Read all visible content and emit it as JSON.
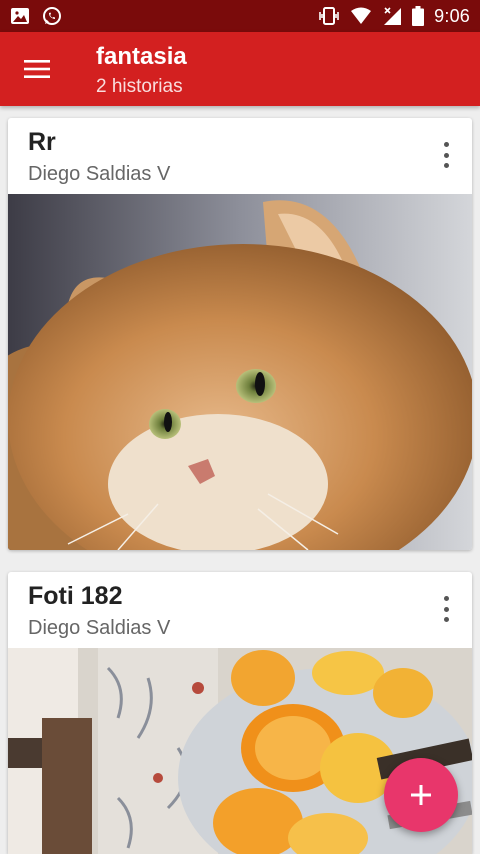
{
  "status_bar": {
    "time": "9:06",
    "icons": [
      "image-icon",
      "whatsapp-icon",
      "vibrate-icon",
      "wifi-icon",
      "signal-icon",
      "battery-icon"
    ]
  },
  "app_bar": {
    "title": "fantasia",
    "subtitle": "2 historias",
    "color": "#d32020"
  },
  "stories": [
    {
      "title": "Rr",
      "author": "Diego Saldias V",
      "image": "orange long-haired cat with green eyes"
    },
    {
      "title": "Foti 182",
      "author": "Diego Saldias V",
      "image": "orange peels on a plate"
    }
  ],
  "fab": {
    "icon": "plus-icon",
    "color": "#e8366b"
  }
}
